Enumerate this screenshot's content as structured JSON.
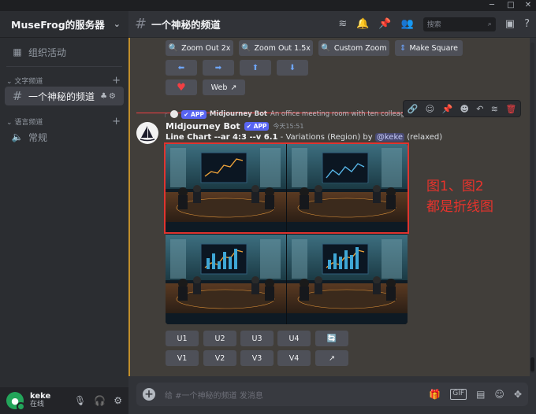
{
  "window": {
    "minimize": "─",
    "maximize": "□",
    "close": "✕"
  },
  "server": {
    "name": "MuseFrog的服务器"
  },
  "sidebar": {
    "events_label": "组织活动",
    "text_category": "文字频道",
    "text_channel": "一个神秘的频道",
    "voice_category": "语言频道",
    "voice_channel": "常规"
  },
  "user": {
    "name": "keke",
    "status": "在线"
  },
  "header": {
    "channel": "一个神秘的频道",
    "search_placeholder": "搜索"
  },
  "top_buttons": {
    "zoom_out_2x": "Zoom Out 2x",
    "zoom_out_15x": "Zoom Out 1.5x",
    "custom_zoom": "Custom Zoom",
    "make_square": "Make Square",
    "web": "Web"
  },
  "reply": {
    "bot": "Midjourney Bot",
    "prompt": "An office meeting room with ten colleagues,five m"
  },
  "message": {
    "bot_name": "Midjourney Bot",
    "app_tag": "APP",
    "time": "今天15:51",
    "title": "Line Chart --ar 4:3 --v 6.1",
    "variation": "- Variations (Region) by",
    "mention": "@keke",
    "mode": "(relaxed)"
  },
  "annotation": {
    "line1": "图1、图2",
    "line2": "都是折线图"
  },
  "action_buttons": {
    "upscale": [
      "U1",
      "U2",
      "U3",
      "U4"
    ],
    "variation": [
      "V1",
      "V2",
      "V3",
      "V4"
    ]
  },
  "composer": {
    "placeholder": "给 #一个神秘的频道 发消息"
  },
  "colors": {
    "accent": "#5865f2",
    "highlight": "#c28f2c",
    "danger": "#f23f43"
  }
}
